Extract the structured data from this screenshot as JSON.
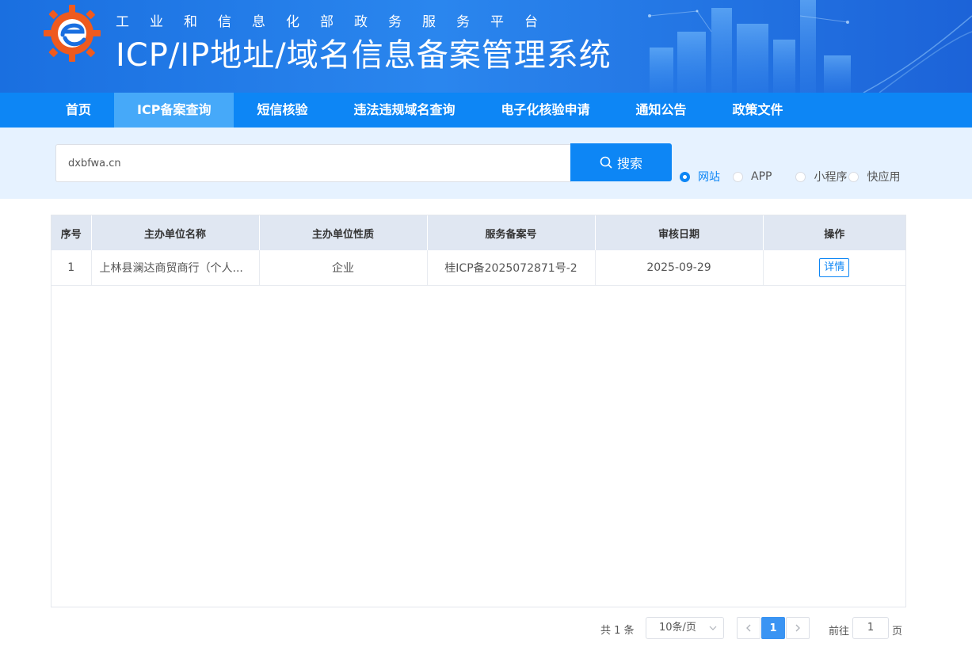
{
  "header": {
    "subtitle": "工业和信息化部政务服务平台",
    "title": "ICP/IP地址/域名信息备案管理系统",
    "colors": {
      "banner": "#1a6fe0",
      "logo": "#ef5a1e"
    }
  },
  "nav": {
    "items": [
      {
        "label": "首页",
        "active": false
      },
      {
        "label": "ICP备案查询",
        "active": true
      },
      {
        "label": "短信核验",
        "active": false
      },
      {
        "label": "违法违规域名查询",
        "active": false
      },
      {
        "label": "电子化核验申请",
        "active": false
      },
      {
        "label": "通知公告",
        "active": false
      },
      {
        "label": "政策文件",
        "active": false
      }
    ],
    "colors": {
      "bar": "#0d86f5",
      "active": "#46a9f9"
    }
  },
  "search": {
    "value": "dxbfwa.cn",
    "button_label": "搜索",
    "button_icon": "search-icon",
    "types": [
      {
        "label": "网站",
        "checked": true
      },
      {
        "label": "APP",
        "checked": false
      },
      {
        "label": "小程序",
        "checked": false
      },
      {
        "label": "快应用",
        "checked": false
      }
    ]
  },
  "table": {
    "columns": [
      "序号",
      "主办单位名称",
      "主办单位性质",
      "服务备案号",
      "审核日期",
      "操作"
    ],
    "rows": [
      {
        "index": "1",
        "org_name": "上林县澜达商贸商行（个人...",
        "org_type": "企业",
        "icp_number": "桂ICP备2025072871号-2",
        "date": "2025-09-29",
        "action": "详情"
      }
    ]
  },
  "pagination": {
    "total": "共 1 条",
    "page_size": "10条/页",
    "current_page": "1",
    "goto_label": "前往",
    "goto_value": "1",
    "page_unit": "页"
  }
}
